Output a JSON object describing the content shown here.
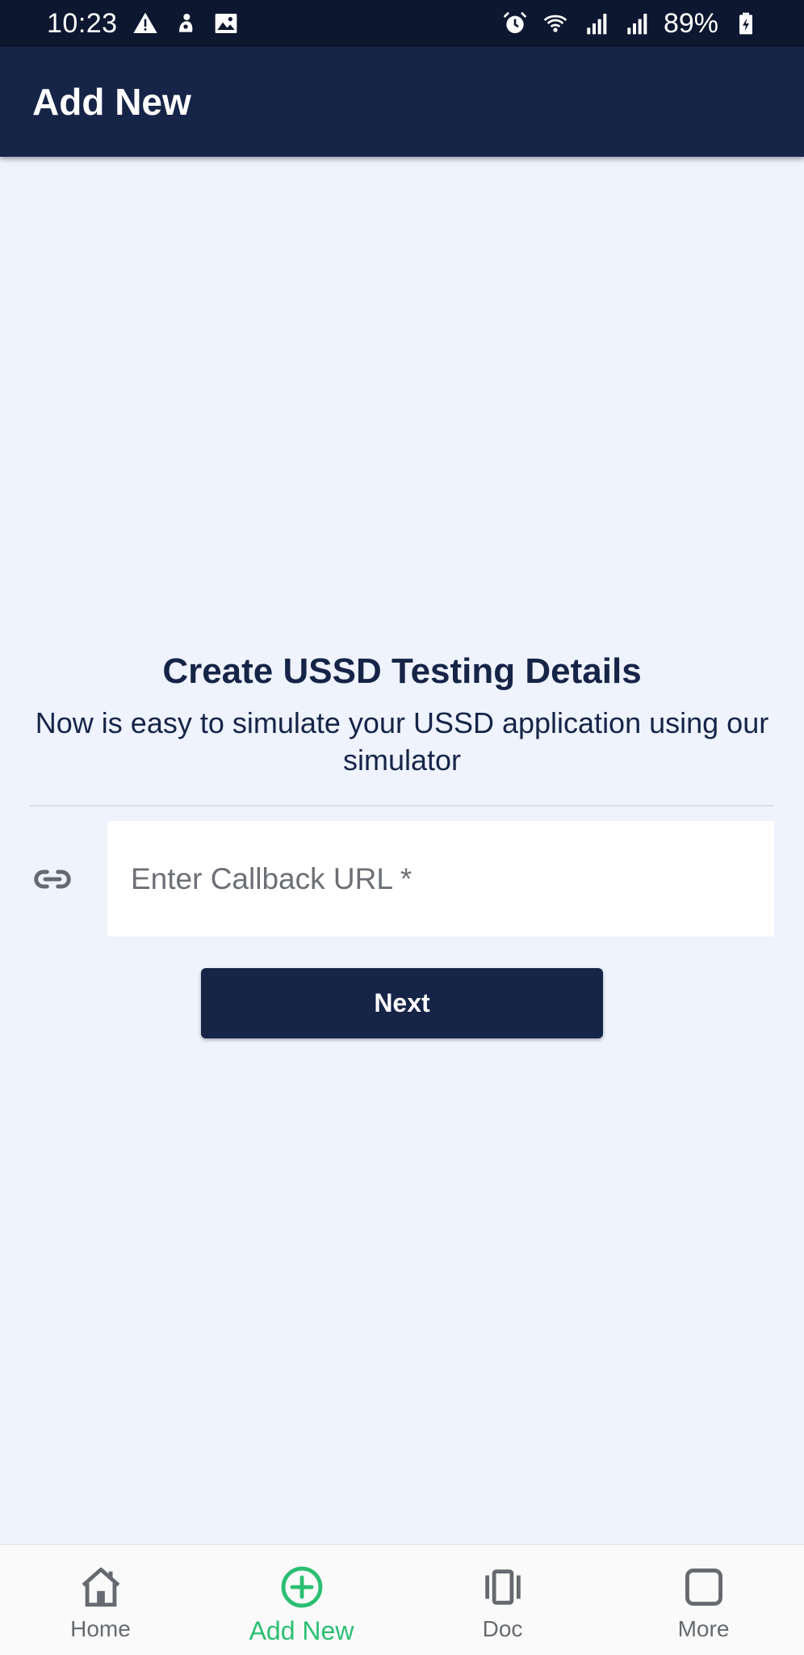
{
  "status_bar": {
    "time": "10:23",
    "battery": "89%",
    "left_icons": [
      "warning-icon",
      "notification-icon",
      "image-icon"
    ],
    "right_icons": [
      "alarm-icon",
      "wifi-icon",
      "signal-icon",
      "signal-icon",
      "battery-charging-icon"
    ]
  },
  "app_bar": {
    "title": "Add New"
  },
  "main": {
    "heading": "Create USSD Testing Details",
    "subheading": "Now is easy to simulate your USSD application using our simulator",
    "callback_field": {
      "placeholder": "Enter Callback URL *",
      "value": ""
    },
    "next_label": "Next"
  },
  "bottom_nav": {
    "items": [
      {
        "label": "Home",
        "icon": "home-icon",
        "active": false
      },
      {
        "label": "Add New",
        "icon": "add-circle-icon",
        "active": true
      },
      {
        "label": "Doc",
        "icon": "carousel-icon",
        "active": false
      },
      {
        "label": "More",
        "icon": "square-icon",
        "active": false
      }
    ]
  },
  "colors": {
    "status_bar": "#0e1730",
    "app_bar": "#162447",
    "background": "#eef3fd",
    "accent_active": "#2bbf72",
    "button": "#162447"
  }
}
